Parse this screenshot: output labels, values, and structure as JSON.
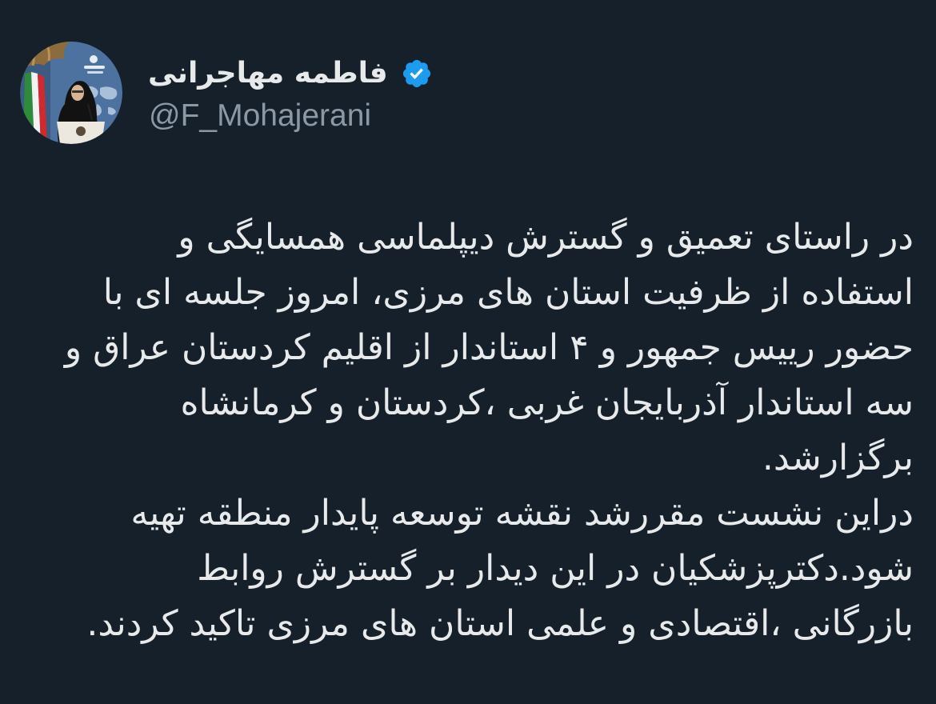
{
  "profile": {
    "display_name": "فاطمه مهاجرانی",
    "handle": "@F_Mohajerani",
    "verified": true,
    "verified_icon": "verified-badge-icon",
    "avatar_icon": "profile-photo"
  },
  "tweet": {
    "lines": [
      "در راستای تعمیق و گسترش دیپلماسی همسایگی و",
      "استفاده از ظرفیت استان های مرزی، امروز جلسه ای با",
      "حضور رییس جمهور و ۴ استاندار از اقلیم کردستان عراق و",
      "سه استاندار آذربایجان غربی ،کردستان و کرمانشاه",
      "برگزارشد.",
      "دراین نشست مقررشد نقشه توسعه پایدار منطقه تهیه",
      "شود.دکترپزشکیان در این دیدار بر گسترش روابط",
      "بازرگانی ،اقتصادی و علمی استان های مرزی تاکید کردند."
    ]
  },
  "colors": {
    "background": "#15202b",
    "text": "#e7e9ea",
    "handle": "#8b98a5",
    "verified": "#1d9bf0"
  }
}
